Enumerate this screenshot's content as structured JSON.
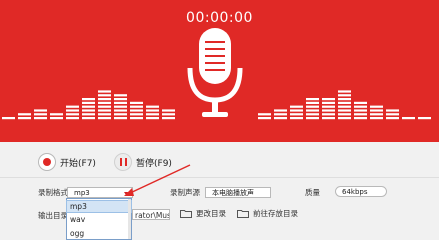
{
  "header": {
    "timer": "00:00:00",
    "equalizer_levels": [
      0.05,
      0.12,
      0.22,
      0.18,
      0.32,
      0.45,
      0.62,
      0.55,
      0.4,
      0.3,
      0.22,
      0.12,
      0.06,
      0.0,
      0.0,
      0.06,
      0.14,
      0.2,
      0.34,
      0.45,
      0.5,
      0.62,
      0.4,
      0.3,
      0.2,
      0.08,
      0.06
    ]
  },
  "controls": {
    "start_label": "开始(F7)",
    "pause_label": "暂停(F9)"
  },
  "settings": {
    "format_label": "录制格式",
    "format_value": "mp3",
    "source_label": "录制声源",
    "source_value": "本电脑播放声",
    "quality_label": "质量",
    "quality_value": "64kbps",
    "output_label": "输出目录",
    "output_path": "rator\\Music",
    "change_dir_label": "更改目录",
    "open_dir_label": "前往存放目录"
  },
  "format_dropdown": {
    "options": [
      "mp3",
      "wav",
      "ogg"
    ],
    "selected_index": 0
  },
  "colors": {
    "banner": "#e02926",
    "accent": "#e02926",
    "dropdown_selected": "#d3e4f5"
  }
}
